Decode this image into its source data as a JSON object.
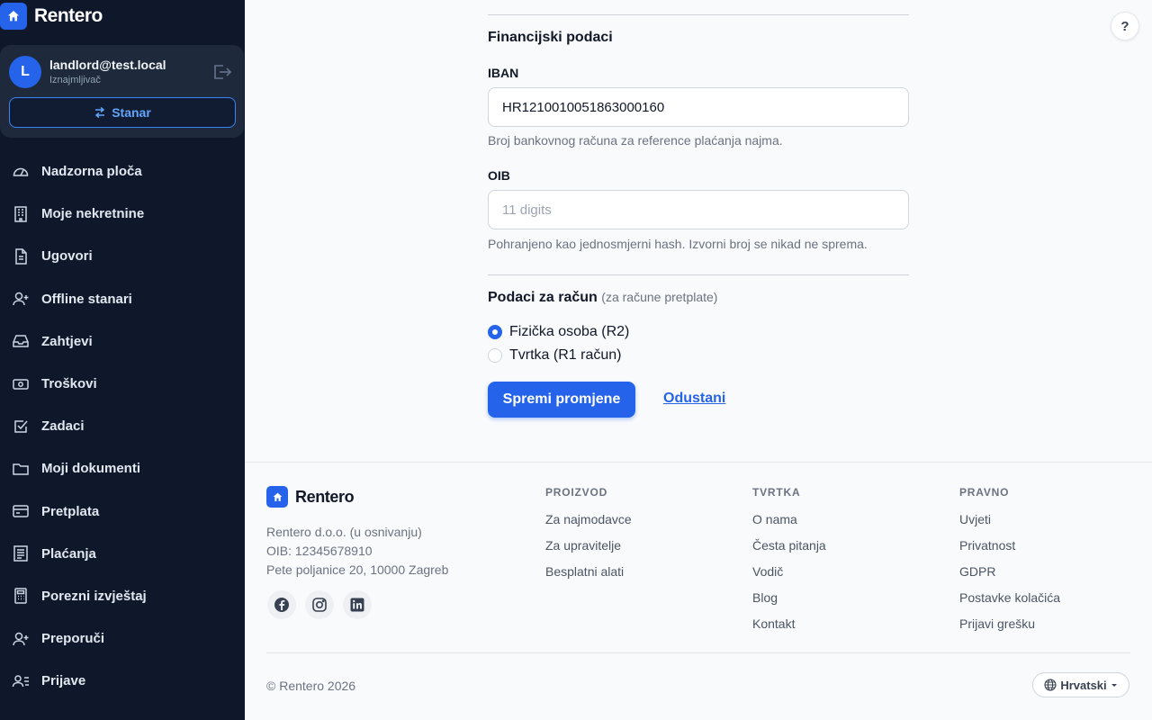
{
  "sidebar": {
    "brand": "Rentero",
    "user": {
      "initial": "L",
      "email": "landlord@test.local",
      "role": "Iznajmljivač",
      "switch_label": "Stanar"
    },
    "items": [
      {
        "label": "Nadzorna ploča",
        "icon": "gauge-icon"
      },
      {
        "label": "Moje nekretnine",
        "icon": "building-icon"
      },
      {
        "label": "Ugovori",
        "icon": "document-icon"
      },
      {
        "label": "Offline stanari",
        "icon": "user-plus-icon"
      },
      {
        "label": "Zahtjevi",
        "icon": "inbox-icon"
      },
      {
        "label": "Troškovi",
        "icon": "banknote-icon"
      },
      {
        "label": "Zadaci",
        "icon": "checkbox-icon"
      },
      {
        "label": "Moji dokumenti",
        "icon": "folder-icon"
      },
      {
        "label": "Pretplata",
        "icon": "credit-card-icon"
      },
      {
        "label": "Plaćanja",
        "icon": "receipt-icon"
      },
      {
        "label": "Porezni izvještaj",
        "icon": "calculator-icon"
      },
      {
        "label": "Preporuči",
        "icon": "user-plus-icon"
      },
      {
        "label": "Prijave",
        "icon": "user-list-icon"
      }
    ]
  },
  "help": "?",
  "form": {
    "financial_title": "Financijski podaci",
    "iban_label": "IBAN",
    "iban_value": "HR1210010051863000160",
    "iban_help": "Broj bankovnog računa za reference plaćanja najma.",
    "oib_label": "OIB",
    "oib_placeholder": "11 digits",
    "oib_help": "Pohranjeno kao jednosmjerni hash. Izvorni broj se nikad ne sprema.",
    "invoice_title": "Podaci za račun",
    "invoice_sub": "(za račune pretplate)",
    "options": [
      {
        "label": "Fizička osoba (R2)",
        "checked": true
      },
      {
        "label": "Tvrtka (R1 račun)",
        "checked": false
      }
    ],
    "save": "Spremi promjene",
    "cancel": "Odustani"
  },
  "footer": {
    "brand": "Rentero",
    "company": "Rentero d.o.o. (u osnivanju)",
    "oib": "OIB: 12345678910",
    "address": "Pete poljanice 20, 10000 Zagreb",
    "social": [
      "facebook-icon",
      "instagram-icon",
      "linkedin-icon"
    ],
    "columns": [
      {
        "title": "PROIZVOD",
        "links": [
          "Za najmodavce",
          "Za upravitelje",
          "Besplatni alati"
        ]
      },
      {
        "title": "TVRTKA",
        "links": [
          "O nama",
          "Česta pitanja",
          "Vodič",
          "Blog",
          "Kontakt"
        ]
      },
      {
        "title": "PRAVNO",
        "links": [
          "Uvjeti",
          "Privatnost",
          "GDPR",
          "Postavke kolačića",
          "Prijavi grešku"
        ]
      }
    ],
    "copyright": "© Rentero 2026",
    "language": "Hrvatski"
  },
  "colors": {
    "sidebar_bg": "#0f172a",
    "accent": "#2563eb",
    "page_bg": "#f8fafc"
  }
}
